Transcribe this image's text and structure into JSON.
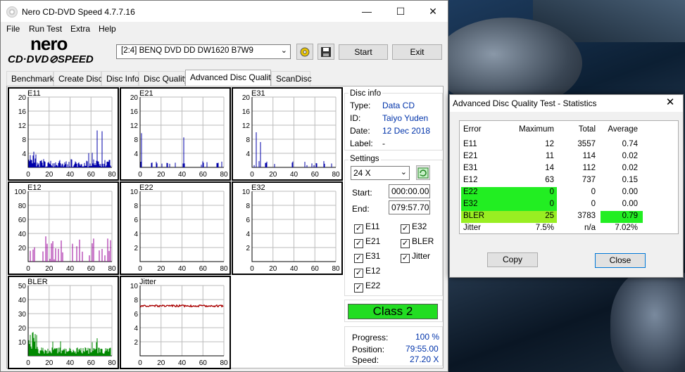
{
  "window": {
    "title": "Nero CD-DVD Speed 4.7.7.16",
    "min": "—",
    "max": "☐",
    "close": "✕"
  },
  "menu": [
    "File",
    "Run Test",
    "Extra",
    "Help"
  ],
  "logo": {
    "top": "nero",
    "bottom": "CD·DVD⊘SPEED"
  },
  "drive": "[2:4]   BENQ DVD DD DW1620 B7W9",
  "buttons": {
    "start": "Start",
    "exit": "Exit"
  },
  "tabs": [
    "Benchmark",
    "Create Disc",
    "Disc Info",
    "Disc Quality",
    "Advanced Disc Quality",
    "ScanDisc"
  ],
  "active_tab": 4,
  "graphs": [
    {
      "name": "E11",
      "ylabels": [
        "20",
        "16",
        "12",
        "8",
        "4"
      ],
      "xlabels": [
        "0",
        "20",
        "40",
        "60",
        "80"
      ],
      "color": "#0000aa"
    },
    {
      "name": "E21",
      "ylabels": [
        "20",
        "16",
        "12",
        "8",
        "4"
      ],
      "xlabels": [
        "0",
        "20",
        "40",
        "60",
        "80"
      ],
      "color": "#0000aa"
    },
    {
      "name": "E31",
      "ylabels": [
        "20",
        "16",
        "12",
        "8",
        "4"
      ],
      "xlabels": [
        "0",
        "20",
        "40",
        "60",
        "80"
      ],
      "color": "#0000aa"
    },
    {
      "name": "E12",
      "ylabels": [
        "100",
        "80",
        "60",
        "40",
        "20"
      ],
      "xlabels": [
        "0",
        "20",
        "40",
        "60",
        "80"
      ],
      "color": "#990099"
    },
    {
      "name": "E22",
      "ylabels": [
        "10",
        "8",
        "6",
        "4",
        "2"
      ],
      "xlabels": [
        "0",
        "20",
        "40",
        "60",
        "80"
      ],
      "color": "#0000aa"
    },
    {
      "name": "E32",
      "ylabels": [
        "10",
        "8",
        "6",
        "4",
        "2"
      ],
      "xlabels": [
        "0",
        "20",
        "40",
        "60",
        "80"
      ],
      "color": "#0000aa"
    },
    {
      "name": "BLER",
      "ylabels": [
        "50",
        "40",
        "30",
        "20",
        "10"
      ],
      "xlabels": [
        "0",
        "20",
        "40",
        "60",
        "80"
      ],
      "color": "#008800"
    },
    {
      "name": "Jitter",
      "ylabels": [
        "10",
        "8",
        "6",
        "4",
        "2"
      ],
      "xlabels": [
        "0",
        "20",
        "40",
        "60",
        "80"
      ],
      "color": "#aa0000"
    }
  ],
  "disc_info": {
    "title": "Disc info",
    "type_label": "Type:",
    "type": "Data CD",
    "id_label": "ID:",
    "id": "Taiyo Yuden",
    "date_label": "Date:",
    "date": "12 Dec 2018",
    "label_label": "Label:",
    "label": "-"
  },
  "settings": {
    "title": "Settings",
    "speed": "24 X",
    "start_label": "Start:",
    "start": "000:00.00",
    "end_label": "End:",
    "end": "079:57.70"
  },
  "checks": [
    {
      "label": "E11",
      "checked": true
    },
    {
      "label": "E32",
      "checked": true
    },
    {
      "label": "E21",
      "checked": true
    },
    {
      "label": "BLER",
      "checked": true
    },
    {
      "label": "E31",
      "checked": true
    },
    {
      "label": "Jitter",
      "checked": true
    },
    {
      "label": "E12",
      "checked": true
    },
    {
      "label": "E22",
      "checked": true
    }
  ],
  "class": "Class 2",
  "progress": {
    "progress_label": "Progress:",
    "progress": "100 %",
    "position_label": "Position:",
    "position": "79:55.00",
    "speed_label": "Speed:",
    "speed": "27.20 X"
  },
  "stats": {
    "title": "Advanced Disc Quality Test - Statistics",
    "close": "✕",
    "headers": [
      "Error",
      "Maximum",
      "Total",
      "Average"
    ],
    "rows": [
      [
        "E11",
        "12",
        "3557",
        "0.74"
      ],
      [
        "E21",
        "11",
        "114",
        "0.02"
      ],
      [
        "E31",
        "14",
        "112",
        "0.02"
      ],
      [
        "E12",
        "63",
        "737",
        "0.15"
      ],
      [
        "E22",
        "0",
        "0",
        "0.00"
      ],
      [
        "E32",
        "0",
        "0",
        "0.00"
      ],
      [
        "BLER",
        "25",
        "3783",
        "0.79"
      ],
      [
        "Jitter",
        "7.5%",
        "n/a",
        "7.02%"
      ]
    ],
    "highlight_color": "#22ee22",
    "copy": "Copy",
    "close_btn": "Close"
  }
}
